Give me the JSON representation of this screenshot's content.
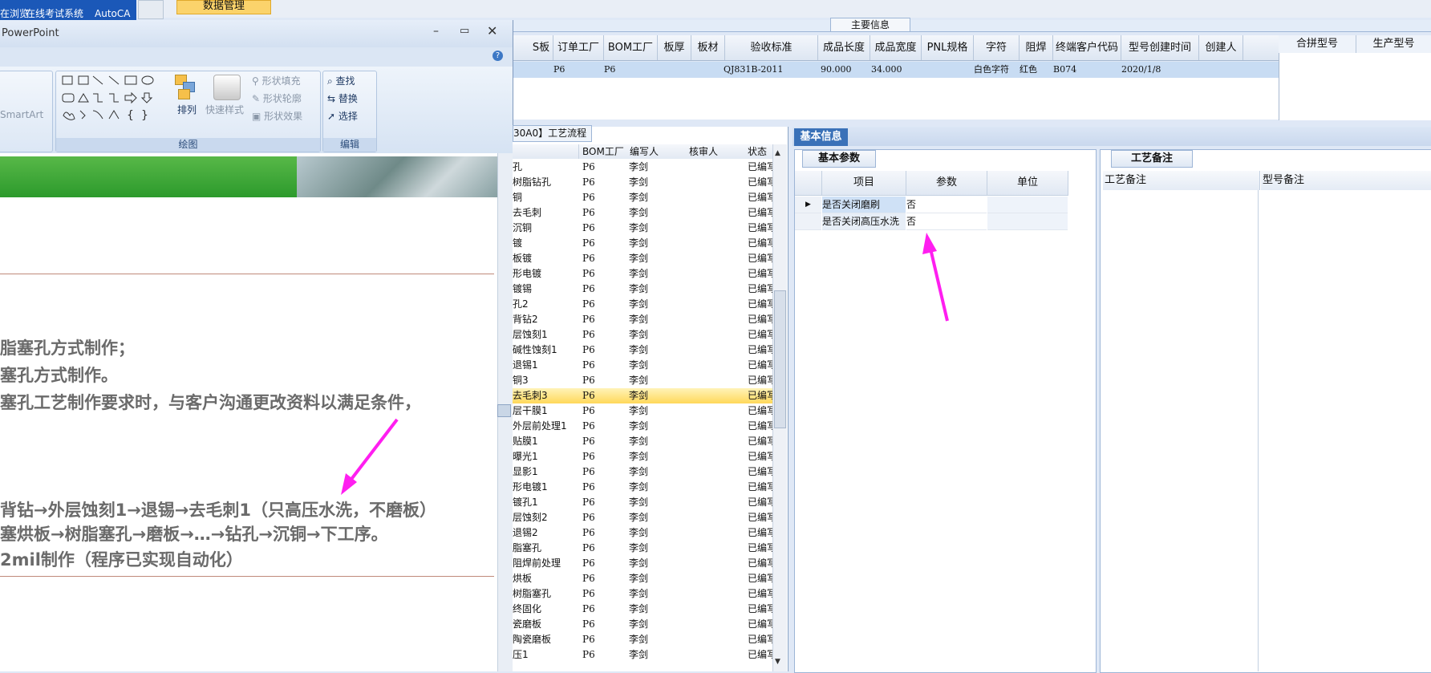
{
  "taskbar": {
    "item1": "在浏览",
    "item2": "在线考试系统",
    "item3": "AutoCA",
    "data_mgmt": "数据管理"
  },
  "main_info": {
    "label": "主要信息",
    "headers": [
      "S板",
      "订单工厂",
      "BOM工厂",
      "板厚",
      "板材",
      "验收标准",
      "成品长度",
      "成品宽度",
      "PNL规格",
      "字符",
      "阻焊",
      "终端客户代码",
      "型号创建时间",
      "创建人"
    ],
    "row": {
      "order_factory": "P6",
      "bom_factory": "P6",
      "standard": "QJ831B-2011",
      "length": "90.000",
      "width": "34.000",
      "char": "白色字符",
      "mask": "红色",
      "customer": "B074",
      "created": "2020/1/8"
    },
    "right_headers": [
      "合拼型号",
      "生产型号"
    ]
  },
  "ppt": {
    "title": "PowerPoint",
    "ribbon": {
      "left_items": [
        "SmartArt"
      ],
      "draw_group_label": "绘图",
      "arrange": "排列",
      "quick_style": "快速样式",
      "shape_fill": "形状填充",
      "shape_outline": "形状轮廓",
      "shape_effect": "形状效果",
      "edit_group_label": "编辑",
      "find": "查找",
      "replace": "替换",
      "select": "选择"
    },
    "slide_lines": [
      "脂塞孔方式制作；",
      "塞孔方式制作。",
      "塞孔工艺制作要求时，与客户沟通更改资料以满足条件，",
      "背钻→外层蚀刻1→退锡→去毛刺1（只高压水洗，不磨板）",
      "塞烘板→树脂塞孔→磨板→…→钻孔→沉铜→下工序。",
      "2mil制作（程序已实现自动化）"
    ]
  },
  "process": {
    "tab_label": "30A0】工艺流程",
    "headers": [
      "BOM工厂",
      "编写人",
      "核审人",
      "状态"
    ],
    "rows": [
      {
        "name": "孔",
        "factory": "P6",
        "writer": "李剑",
        "status": "已编写"
      },
      {
        "name": "树脂钻孔",
        "factory": "P6",
        "writer": "李剑",
        "status": "已编写"
      },
      {
        "name": "铜",
        "factory": "P6",
        "writer": "李剑",
        "status": "已编写"
      },
      {
        "name": "去毛刺",
        "factory": "P6",
        "writer": "李剑",
        "status": "已编写"
      },
      {
        "name": "沉铜",
        "factory": "P6",
        "writer": "李剑",
        "status": "已编写"
      },
      {
        "name": "镀",
        "factory": "P6",
        "writer": "李剑",
        "status": "已编写"
      },
      {
        "name": "板镀",
        "factory": "P6",
        "writer": "李剑",
        "status": "已编写"
      },
      {
        "name": "形电镀",
        "factory": "P6",
        "writer": "李剑",
        "status": "已编写"
      },
      {
        "name": "镀锡",
        "factory": "P6",
        "writer": "李剑",
        "status": "已编写"
      },
      {
        "name": "孔2",
        "factory": "P6",
        "writer": "李剑",
        "status": "已编写"
      },
      {
        "name": "背钻2",
        "factory": "P6",
        "writer": "李剑",
        "status": "已编写"
      },
      {
        "name": "层蚀刻1",
        "factory": "P6",
        "writer": "李剑",
        "status": "已编写"
      },
      {
        "name": "碱性蚀刻1",
        "factory": "P6",
        "writer": "李剑",
        "status": "已编写"
      },
      {
        "name": "退锡1",
        "factory": "P6",
        "writer": "李剑",
        "status": "已编写"
      },
      {
        "name": "铜3",
        "factory": "P6",
        "writer": "李剑",
        "status": "已编写"
      },
      {
        "name": "去毛刺3",
        "factory": "P6",
        "writer": "李剑",
        "status": "已编写"
      },
      {
        "name": "层干膜1",
        "factory": "P6",
        "writer": "李剑",
        "status": "已编写"
      },
      {
        "name": "外层前处理1",
        "factory": "P6",
        "writer": "李剑",
        "status": "已编写"
      },
      {
        "name": "贴膜1",
        "factory": "P6",
        "writer": "李剑",
        "status": "已编写"
      },
      {
        "name": "曝光1",
        "factory": "P6",
        "writer": "李剑",
        "status": "已编写"
      },
      {
        "name": "显影1",
        "factory": "P6",
        "writer": "李剑",
        "status": "已编写"
      },
      {
        "name": "形电镀1",
        "factory": "P6",
        "writer": "李剑",
        "status": "已编写"
      },
      {
        "name": "镀孔1",
        "factory": "P6",
        "writer": "李剑",
        "status": "已编写"
      },
      {
        "name": "层蚀刻2",
        "factory": "P6",
        "writer": "李剑",
        "status": "已编写"
      },
      {
        "name": "退锡2",
        "factory": "P6",
        "writer": "李剑",
        "status": "已编写"
      },
      {
        "name": "脂塞孔",
        "factory": "P6",
        "writer": "李剑",
        "status": "已编写"
      },
      {
        "name": "阻焊前处理",
        "factory": "P6",
        "writer": "李剑",
        "status": "已编写"
      },
      {
        "name": "烘板",
        "factory": "P6",
        "writer": "李剑",
        "status": "已编写"
      },
      {
        "name": "树脂塞孔",
        "factory": "P6",
        "writer": "李剑",
        "status": "已编写"
      },
      {
        "name": "终固化",
        "factory": "P6",
        "writer": "李剑",
        "status": "已编写"
      },
      {
        "name": "瓷磨板",
        "factory": "P6",
        "writer": "李剑",
        "status": "已编写"
      },
      {
        "name": "陶瓷磨板",
        "factory": "P6",
        "writer": "李剑",
        "status": "已编写"
      },
      {
        "name": "压1",
        "factory": "P6",
        "writer": "李剑",
        "status": "已编写"
      }
    ],
    "selected_index": 15
  },
  "basic_info": {
    "tab_label": "基本信息",
    "params_tab": "基本参数",
    "headers": [
      "项目",
      "参数",
      "单位"
    ],
    "rows": [
      {
        "item": "是否关闭磨刷",
        "value": "否"
      },
      {
        "item": "是否关闭高压水洗",
        "value": "否"
      }
    ]
  },
  "craft": {
    "tab_label": "工艺备注",
    "headers": [
      "工艺备注",
      "型号备注"
    ]
  },
  "colors": {
    "arrow": "#ff1ef0",
    "selected_row": "#ffe07a",
    "banner_green": "#2c9a2c"
  }
}
